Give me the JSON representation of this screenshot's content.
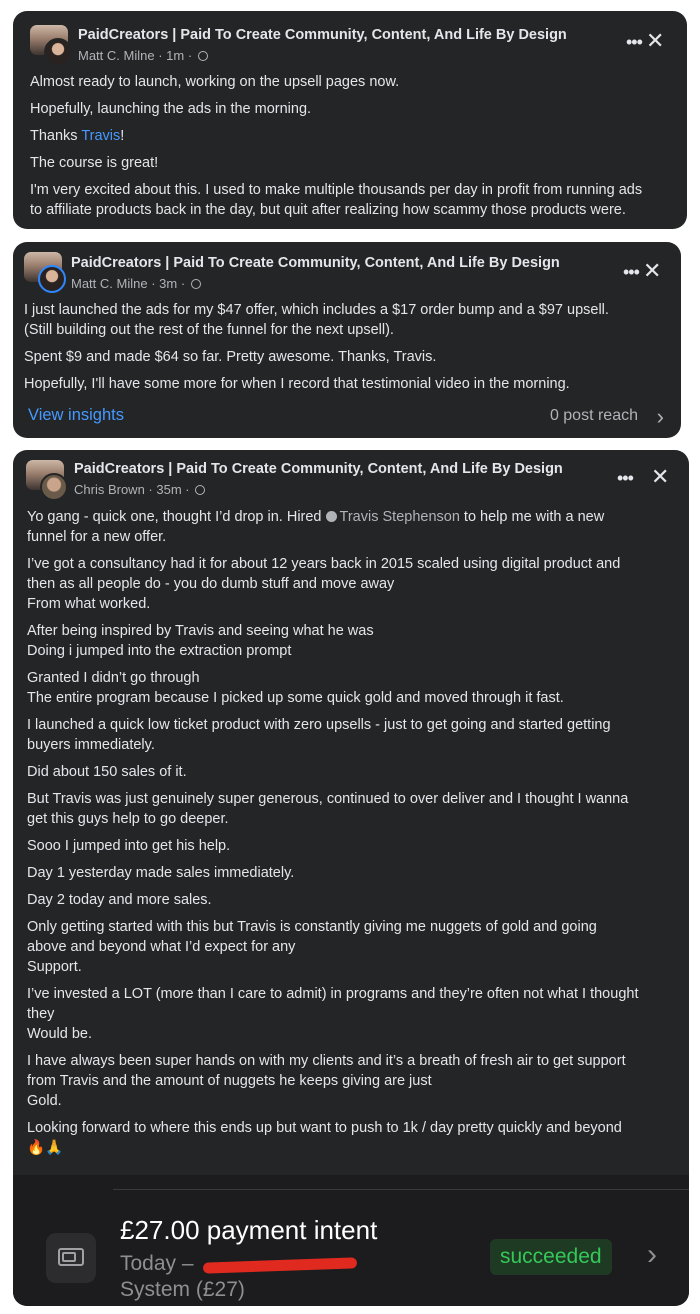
{
  "posts": [
    {
      "group": "PaidCreators | Paid To Create Community, Content, And Life By Design",
      "author": "Matt C. Milne",
      "time": "1m",
      "paragraphs": [
        "Almost ready to launch, working on the upsell pages now.",
        "Hopefully, launching the ads in the morning.",
        "",
        "The course is great!",
        "I'm very excited about this. I used to make multiple thousands per day in profit from running ads\nto affiliate products back in the day, but quit after realizing how scammy those products were."
      ],
      "thanks_prefix": "Thanks ",
      "thanks_link": "Travis",
      "thanks_suffix": "!"
    },
    {
      "group": "PaidCreators | Paid To Create Community, Content, And Life By Design",
      "author": "Matt C. Milne",
      "time": "3m",
      "paragraphs": [
        "I just launched the ads for my $47 offer, which includes a $17 order bump and a $97 upsell.\n(Still building out the rest of the funnel for the next upsell).",
        "Spent $9 and made $64 so far. Pretty awesome. Thanks, Travis.",
        "Hopefully, I'll have some more for when I record that testimonial video in the morning."
      ],
      "insights_label": "View insights",
      "reach": "0 post reach"
    },
    {
      "group": "PaidCreators | Paid To Create Community, Content, And Life By Design",
      "author": "Chris Brown",
      "time": "35m",
      "intro_before": "Yo gang - quick one, thought I’d drop in. Hired ",
      "intro_mention": "Travis Stephenson",
      "intro_after": " to help me with a new\nfunnel for a new offer.",
      "paragraphs": [
        "I’ve got a consultancy had it for about 12 years back in 2015 scaled using digital product and\nthen as all people do - you do dumb stuff and move away\nFrom what worked.",
        "After being inspired by Travis and seeing what he was\nDoing i jumped into the extraction prompt",
        "Granted I didn’t go through\nThe entire program because I picked up some quick gold and moved through it fast.",
        "I launched a quick low ticket product with zero upsells - just to get going and started getting\nbuyers immediately.",
        "Did about 150 sales of it.",
        "But Travis was just genuinely super generous, continued to over deliver and I thought I wanna\nget this guys help to go deeper.",
        "Sooo I jumped into get his help.",
        "Day 1 yesterday made sales immediately.",
        "Day 2 today and more sales.",
        "Only getting started with this but Travis is constantly giving me nuggets of gold and going\nabove and beyond what I’d expect for any\nSupport.",
        "I’ve invested a LOT (more than I care to admit) in programs and they’re often not what I thought\nthey\nWould be.",
        "I have always been super hands on with my clients and it’s a breath of fresh air to get support\nfrom Travis and the amount of nuggets he keeps giving are just\nGold.",
        "Looking forward to where this ends up but want to push to 1k / day pretty quickly and beyond\n🔥🙏"
      ]
    }
  ],
  "payment": {
    "amount": "£27.00 payment intent",
    "date_prefix": "Today –",
    "system": "System  (£27)",
    "status": "succeeded",
    "status_color": "#34c759"
  },
  "colors": {
    "card_bg": "#242526",
    "link": "#4599ff"
  }
}
